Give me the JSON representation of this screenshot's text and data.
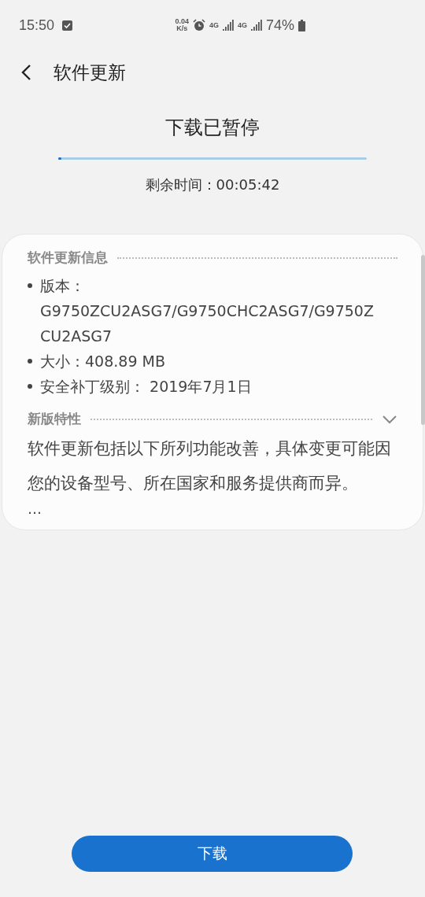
{
  "status_bar": {
    "time": "15:50",
    "net_speed": [
      "0.04",
      "K/s"
    ],
    "sim_labels": [
      "4G",
      "4G"
    ],
    "battery": "74%"
  },
  "header": {
    "title": "软件更新"
  },
  "download": {
    "status": "下载已暂停",
    "level": 0.01,
    "remaining": "剩余时间：00:05:42"
  },
  "info": {
    "heading": "软件更新信息",
    "items": [
      "版本：G9750ZCU2ASG7/G9750CHC2ASG7/G9750ZCU2ASG7",
      "大小：408.89 MB",
      "安全补丁级别： 2019年7月1日"
    ]
  },
  "features": {
    "heading": "新版特性",
    "expanded": false,
    "text": "软件更新包括以下所列功能改善，具体变更可能因您的设备型号、所在国家和服务提供商而异。",
    "more": "…"
  },
  "button": "下载"
}
